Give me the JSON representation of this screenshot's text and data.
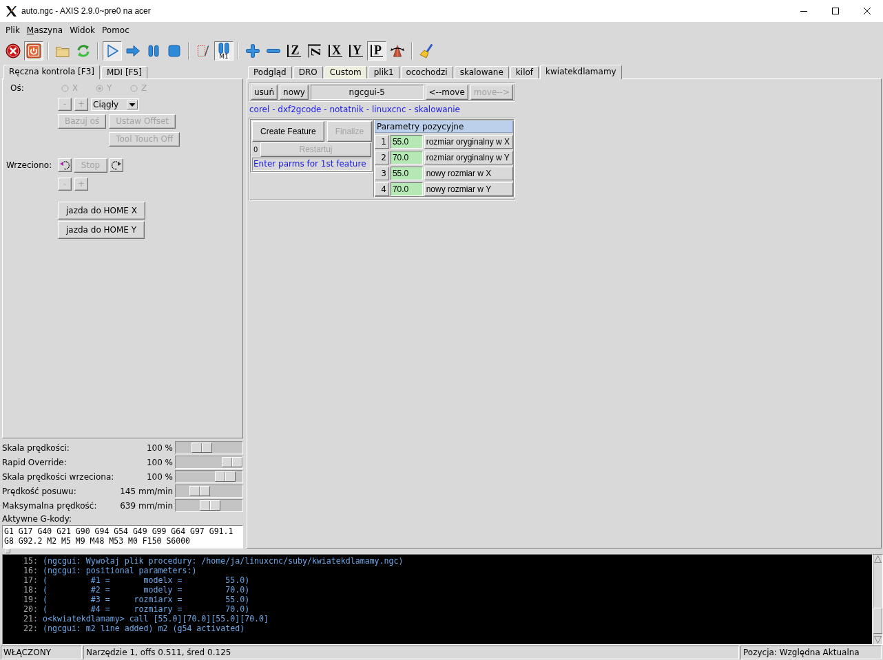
{
  "window": {
    "title": "auto.ngc - AXIS 2.9.0~pre0 na acer"
  },
  "menu": [
    {
      "label": "Plik",
      "mnemonic": false
    },
    {
      "label": "Maszyna",
      "mnemonic": true
    },
    {
      "label": "Widok",
      "mnemonic": false
    },
    {
      "label": "Pomoc",
      "mnemonic": false
    }
  ],
  "toolbar": [
    {
      "pressed": false
    },
    {
      "pressed": true
    },
    {
      "pressed": false
    },
    {
      "pressed": false
    },
    {
      "pressed": true
    },
    {
      "pressed": false
    },
    {
      "pressed": false
    },
    {
      "pressed": false
    },
    {
      "pressed": false
    },
    {
      "pressed": true,
      "label": "M1"
    },
    {
      "pressed": false
    },
    {
      "pressed": false
    },
    {
      "pressed": false,
      "label": "Z"
    },
    {
      "pressed": false,
      "label": "Z",
      "rotated": true
    },
    {
      "pressed": false,
      "label": "X"
    },
    {
      "pressed": false,
      "label": "Y"
    },
    {
      "pressed": true,
      "label": "P"
    },
    {
      "pressed": false
    },
    {
      "pressed": false
    }
  ],
  "left_tabs": [
    {
      "label": "Ręczna kontrola [F3]",
      "selected": true
    },
    {
      "label": "MDI [F5]",
      "selected": false
    }
  ],
  "jog": {
    "axis_label": "Oś:",
    "axes": [
      {
        "label": "X",
        "selected": false,
        "disabled": true
      },
      {
        "label": "Y",
        "selected": true,
        "disabled": true
      },
      {
        "label": "Z",
        "selected": false,
        "disabled": true
      }
    ],
    "minus": {
      "label": "-",
      "disabled": true
    },
    "plus": {
      "label": "+",
      "disabled": true
    },
    "increment": {
      "value": "Ciągły"
    },
    "buttons": [
      {
        "label": "Bazuj oś",
        "disabled": true
      },
      {
        "label": "Ustaw Offset",
        "disabled": true
      },
      {
        "label": "Tool Touch Off",
        "disabled": true
      }
    ]
  },
  "spindle": {
    "label": "Wrzeciono:",
    "stop": {
      "label": "Stop",
      "disabled": true
    },
    "minus": {
      "label": "-",
      "disabled": true
    },
    "plus": {
      "label": "+",
      "disabled": true
    }
  },
  "home_buttons": [
    {
      "label": "jazda do HOME X",
      "disabled": false
    },
    {
      "label": "jazda do HOME Y",
      "disabled": false
    }
  ],
  "overrides": [
    {
      "label": "Skala prędkości:",
      "value": "100 %",
      "level": 0.34
    },
    {
      "label": "Rapid Override:",
      "value": "100 %",
      "level": 1
    },
    {
      "label": "Skala prędkości wrzeciona:",
      "value": "100 %",
      "level": 0.85
    },
    {
      "label": "Prędkość posuwu:",
      "value": "145 mm/min",
      "level": 0.3
    },
    {
      "label": "Maksymalna prędkość:",
      "value": "639 mm/min",
      "level": 0.52
    }
  ],
  "active_gcodes": {
    "label": "Aktywne G-kody:",
    "lines": [
      "G1 G17 G40 G21 G90 G94 G54 G49 G99 G64 G97 G91.1",
      "G8 G92.2 M2 M5 M9 M48 M53 M0 F150 S6000"
    ]
  },
  "right_tabs": [
    {
      "label": "Podgląd",
      "selected": false,
      "highlighted": false
    },
    {
      "label": "DRO",
      "selected": false,
      "highlighted": false
    },
    {
      "label": "Custom",
      "selected": false,
      "highlighted": true
    },
    {
      "label": "plik1",
      "selected": false,
      "highlighted": false
    },
    {
      "label": "ocochodzi",
      "selected": false,
      "highlighted": false
    },
    {
      "label": "skalowane",
      "selected": false,
      "highlighted": false
    },
    {
      "label": "kilof",
      "selected": false,
      "highlighted": false
    },
    {
      "label": "kwiatekdlamamy",
      "selected": true,
      "highlighted": false
    }
  ],
  "ngcgui": {
    "toolbar": [
      {
        "kind": "button",
        "label": "usuń",
        "disabled": false
      },
      {
        "kind": "button",
        "label": "nowy",
        "disabled": false
      },
      {
        "kind": "label",
        "label": "ngcgui-5"
      },
      {
        "kind": "button",
        "label": "<--move",
        "disabled": false
      },
      {
        "kind": "button",
        "label": "move-->",
        "disabled": true
      }
    ],
    "links": "corel - dxf2gcode - notatnik - linuxcnc - skalowanie",
    "create": {
      "label": "Create Feature",
      "disabled": false
    },
    "finalize": {
      "label": "Finalize",
      "disabled": true
    },
    "feature_count": "0",
    "restart": {
      "label": "Restartuj",
      "disabled": true
    },
    "message": "Enter parms for 1st feature",
    "params_title": "Parametry pozycyjne",
    "params": [
      {
        "number": "1",
        "value": "55.0",
        "label": "rozmiar oryginalny w X"
      },
      {
        "number": "2",
        "value": "70.0",
        "label": "rozmiar oryginalny w Y"
      },
      {
        "number": "3",
        "value": "55.0",
        "label": "nowy rozmiar w X"
      },
      {
        "number": "4",
        "value": "70.0",
        "label": "nowy rozmiar w Y"
      }
    ]
  },
  "console": {
    "lines": [
      {
        "number": "15:",
        "text": "(ngcgui: Wywołaj plik procedury: /home/ja/linuxcnc/suby/kwiatekdlamamy.ngc)"
      },
      {
        "number": "16:",
        "text": "(ngcgui: positional parameters:)"
      },
      {
        "number": "17:",
        "text": "(         #1 =       modelx =         55.0)"
      },
      {
        "number": "18:",
        "text": "(         #2 =       modely =         70.0)"
      },
      {
        "number": "19:",
        "text": "(         #3 =     rozmiarx =         55.0)"
      },
      {
        "number": "20:",
        "text": "(         #4 =     rozmiary =         70.0)"
      },
      {
        "number": "21:",
        "text": "o<kwiatekdlamamy> call [55.0][70.0][55.0][70.0]"
      },
      {
        "number": "22:",
        "text": "(ngcgui: m2 line added) m2 (g54 activated)"
      }
    ]
  },
  "status_bar": [
    "WŁĄCZONY",
    "Narzędzie 1, offs 0.511, śred 0.125",
    "Pozycja: Względna Aktualna"
  ]
}
